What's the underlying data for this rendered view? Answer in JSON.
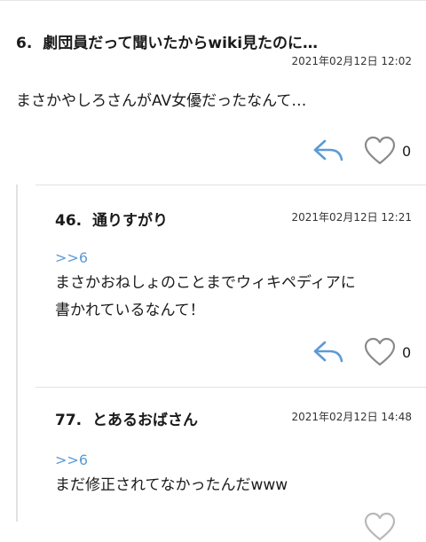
{
  "comments": [
    {
      "number": "6.",
      "name": "劇団員だって聞いたからwiki見たのに…",
      "date": "2021年02月12日 12:02",
      "anchor": "",
      "lines": [
        "まさかやしろさんがAV女優だったなんて…"
      ],
      "likes": "0"
    },
    {
      "number": "46.",
      "name": "通りすがり",
      "date": "2021年02月12日 12:21",
      "anchor": ">>6",
      "lines": [
        "まさかおねしょのことまでウィキペディアに",
        "書かれているなんて！"
      ],
      "likes": "0"
    },
    {
      "number": "77.",
      "name": "とあるおばさん",
      "date": "2021年02月12日 14:48",
      "anchor": ">>6",
      "lines": [
        "まだ修正されてなかったんだwww"
      ],
      "likes": ""
    }
  ],
  "icons": {
    "reply": "reply-arrow-icon",
    "like": "heart-outline-icon"
  },
  "colors": {
    "accent": "#5b9bd5",
    "text": "#1a1a1a",
    "divider": "#e2e2e2"
  }
}
